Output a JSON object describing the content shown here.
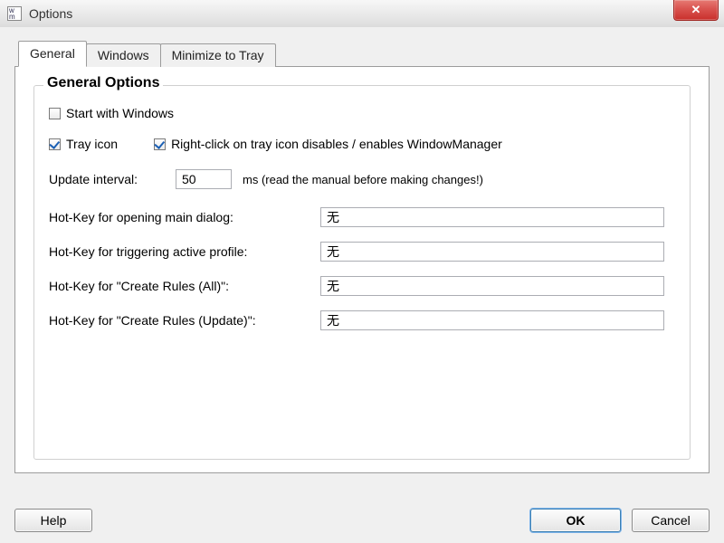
{
  "window": {
    "title": "Options"
  },
  "tabs": {
    "general": "General",
    "windows": "Windows",
    "minimize": "Minimize to Tray"
  },
  "group": {
    "title": "General Options"
  },
  "checkboxes": {
    "start_with_windows": {
      "label": "Start with Windows",
      "checked": false
    },
    "tray_icon": {
      "label": "Tray icon",
      "checked": true
    },
    "right_click_toggle": {
      "label": "Right-click on tray icon disables / enables WindowManager",
      "checked": true
    }
  },
  "update_interval": {
    "label": "Update interval:",
    "value": "50",
    "suffix": "ms (read the manual before making changes!)"
  },
  "hotkeys": {
    "open_main": {
      "label": "Hot-Key for opening main dialog:",
      "value": "无"
    },
    "trigger_profile": {
      "label": "Hot-Key for triggering active profile:",
      "value": "无"
    },
    "create_all": {
      "label": "Hot-Key for \"Create Rules (All)\":",
      "value": "无"
    },
    "create_update": {
      "label": "Hot-Key for \"Create Rules (Update)\":",
      "value": "无"
    }
  },
  "buttons": {
    "help": "Help",
    "ok": "OK",
    "cancel": "Cancel"
  }
}
